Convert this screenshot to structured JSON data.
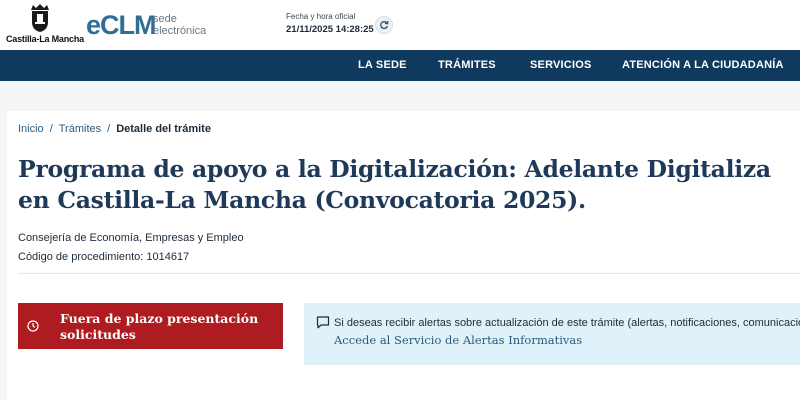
{
  "header": {
    "jccm_logo_text": "Castilla-La Mancha",
    "eclm_logo": "eCLM",
    "eclm_sub_1": "sede",
    "eclm_sub_2": "electrónica",
    "clock_caption": "Fecha y hora oficial",
    "clock_value": "21/11/2025 14:28:25",
    "refresh_icon": "refresh-icon"
  },
  "nav": {
    "items": [
      "LA SEDE",
      "TRÁMITES",
      "SERVICIOS",
      "ATENCIÓN A LA CIUDADANÍA"
    ]
  },
  "breadcrumb": {
    "home": "Inicio",
    "section": "Trámites",
    "current": "Detalle del trámite"
  },
  "procedure": {
    "title": "Programa de apoyo a la Digitalización: Adelante Digitaliza en Castilla-La Mancha (Convocatoria 2025).",
    "department": "Consejería de Economía, Empresas y Empleo",
    "code": "Código de procedimiento: 1014617"
  },
  "status": {
    "text": "Fuera de plazo presentación solicitudes",
    "icon": "clock-icon",
    "color": "#ae1c22"
  },
  "alerts": {
    "text": "Si deseas recibir alertas sobre actualización de este trámite (alertas, notificaciones, comunicaciones",
    "link": "Accede al Servicio de Alertas Informativas",
    "icon": "chat-icon"
  },
  "colors": {
    "nav_bg": "#0f3a5d",
    "title": "#1e3a58",
    "link": "#2c5b80",
    "alert_bg": "#dff2fa"
  }
}
